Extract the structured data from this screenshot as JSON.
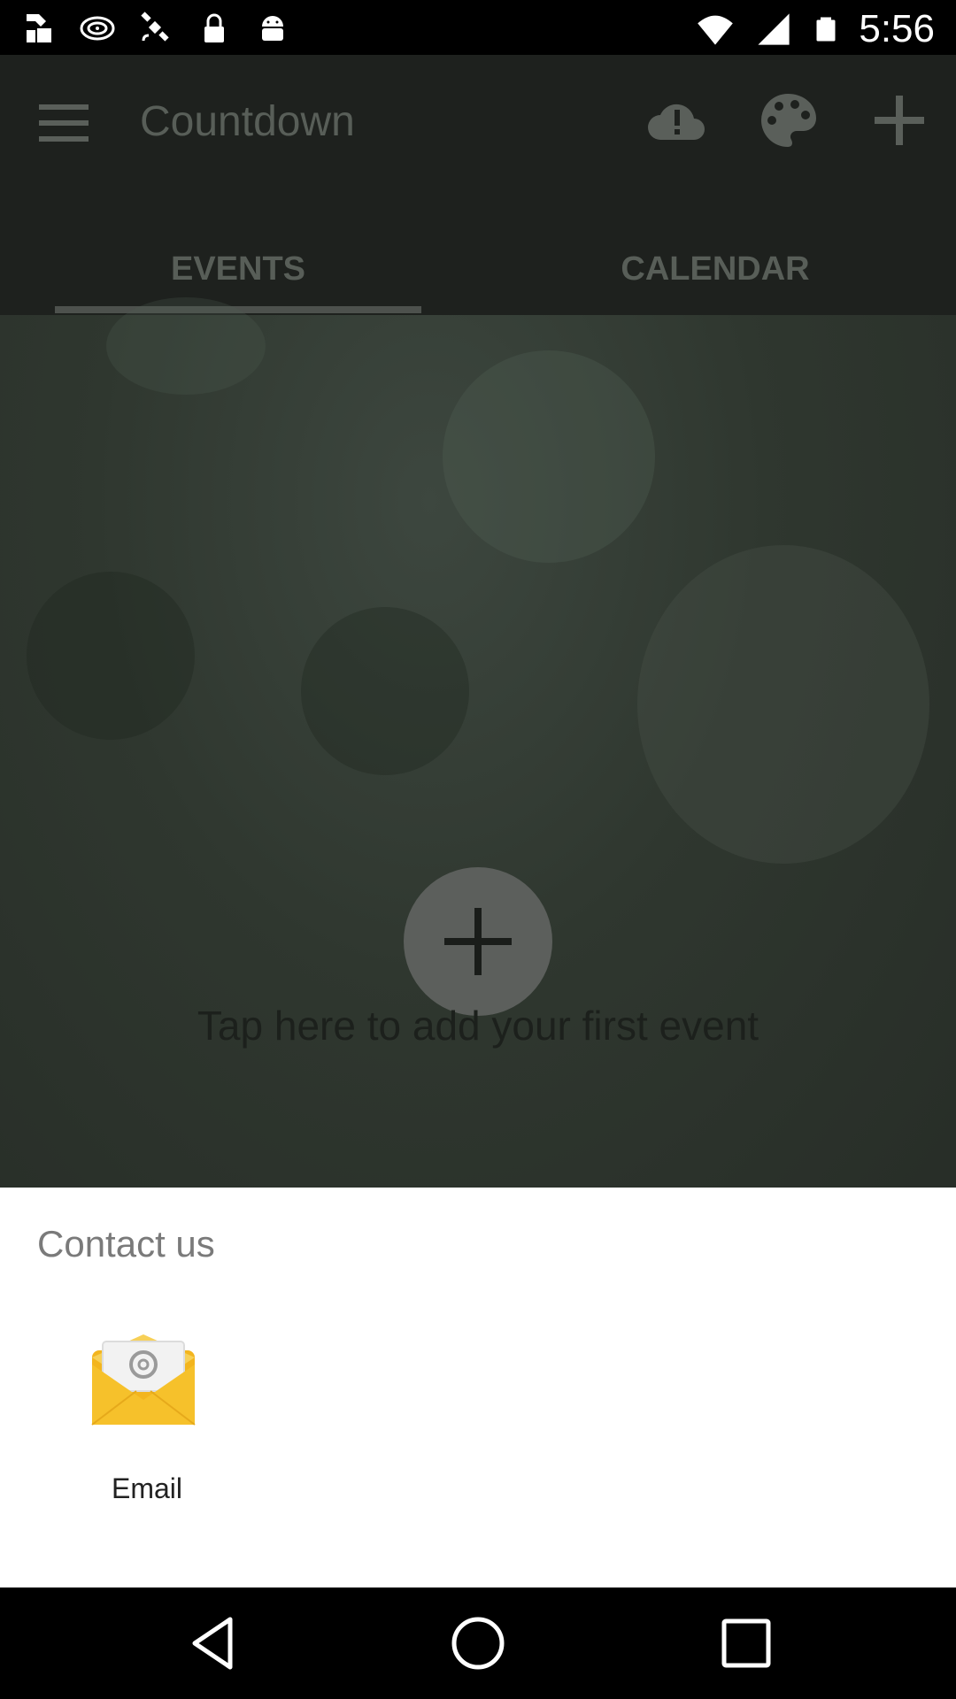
{
  "status_bar": {
    "time": "5:56",
    "left_icons": [
      "notification-icon",
      "tv-icon",
      "satellite-icon",
      "lock-icon",
      "android-icon"
    ],
    "right_icons": [
      "wifi-icon",
      "signal-icon",
      "battery-icon"
    ]
  },
  "toolbar": {
    "title": "Countdown",
    "icons": [
      "menu-icon",
      "cloud-alert-icon",
      "palette-icon",
      "add-icon"
    ]
  },
  "tabs": [
    {
      "label": "EVENTS",
      "selected": true
    },
    {
      "label": "CALENDAR",
      "selected": false
    }
  ],
  "content": {
    "empty_hint": "Tap here to add your first event"
  },
  "sheet": {
    "title": "Contact us",
    "options": [
      {
        "label": "Email",
        "icon": "email-app-icon"
      }
    ]
  },
  "nav_bar": {
    "buttons": [
      "back-icon",
      "home-icon",
      "recents-icon"
    ]
  },
  "colors": {
    "overlay_dark": "#1e211e",
    "sheet_bg": "#ffffff",
    "email_icon_yellow": "#f6c12b"
  }
}
